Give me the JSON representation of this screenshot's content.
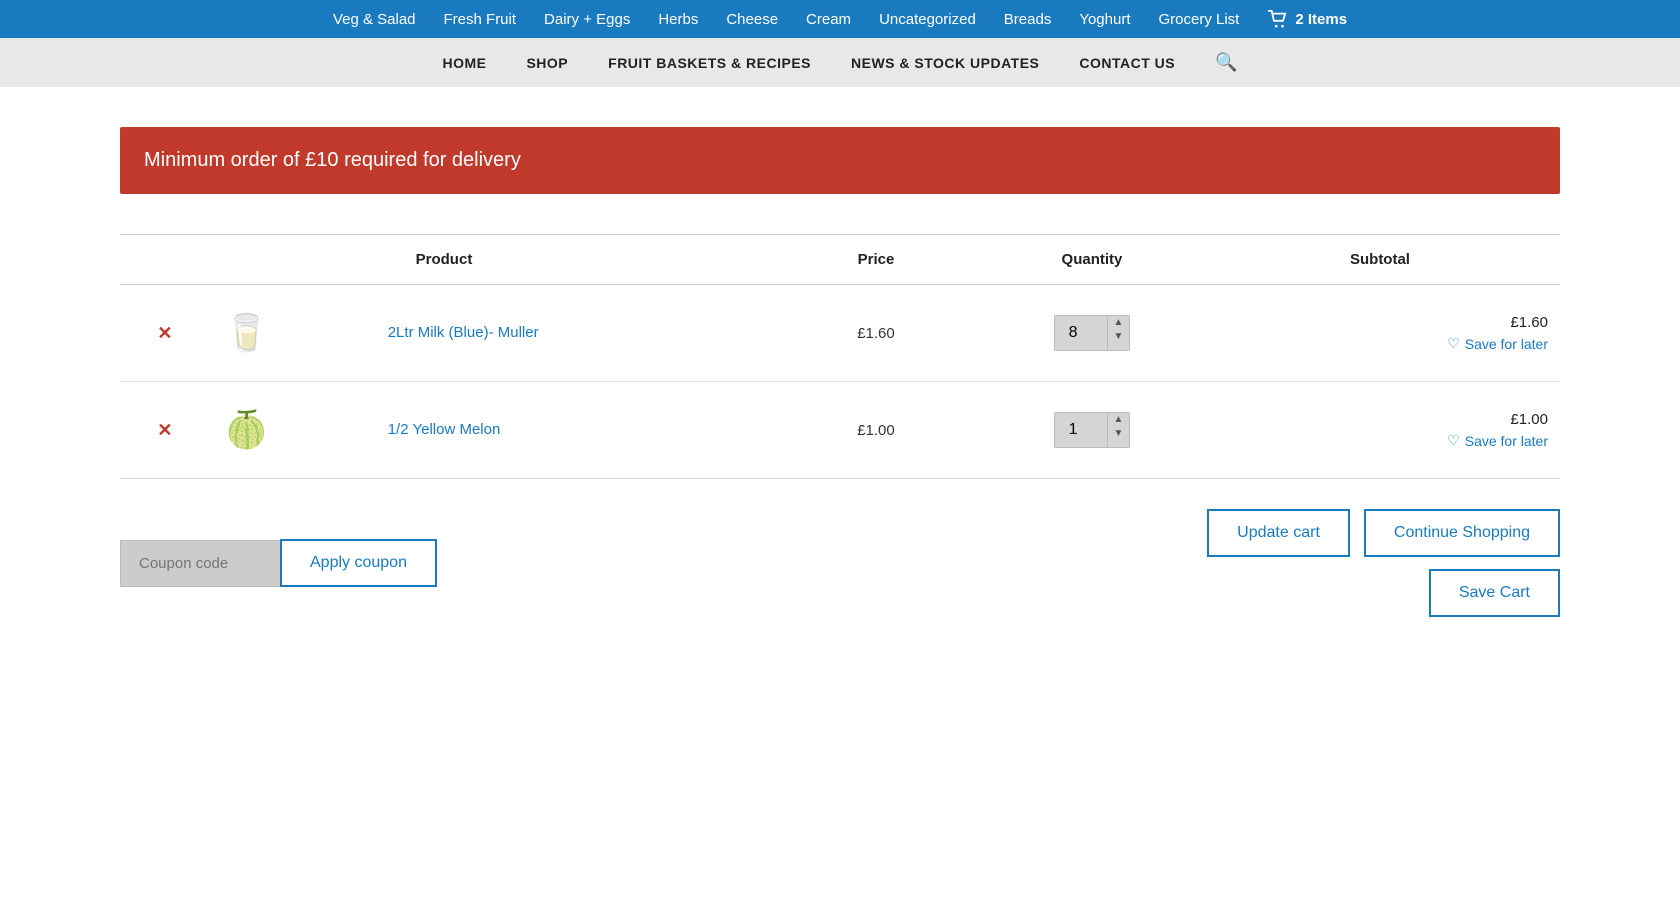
{
  "topNav": {
    "items": [
      {
        "label": "Veg & Salad",
        "href": "#"
      },
      {
        "label": "Fresh Fruit",
        "href": "#"
      },
      {
        "label": "Dairy + Eggs",
        "href": "#"
      },
      {
        "label": "Herbs",
        "href": "#"
      },
      {
        "label": "Cheese",
        "href": "#"
      },
      {
        "label": "Cream",
        "href": "#"
      },
      {
        "label": "Uncategorized",
        "href": "#"
      },
      {
        "label": "Breads",
        "href": "#"
      },
      {
        "label": "Yoghurt",
        "href": "#"
      },
      {
        "label": "Grocery List",
        "href": "#"
      }
    ],
    "cartLabel": "2 Items"
  },
  "mainNav": {
    "items": [
      {
        "label": "HOME",
        "href": "#"
      },
      {
        "label": "SHOP",
        "href": "#"
      },
      {
        "label": "FRUIT BASKETS & RECIPES",
        "href": "#"
      },
      {
        "label": "NEWS & STOCK UPDATES",
        "href": "#"
      },
      {
        "label": "CONTACT US",
        "href": "#"
      }
    ]
  },
  "alert": {
    "message": "Minimum order of £10 required for delivery"
  },
  "cartTable": {
    "headers": {
      "product": "Product",
      "price": "Price",
      "quantity": "Quantity",
      "subtotal": "Subtotal"
    },
    "rows": [
      {
        "id": "row1",
        "productName": "2Ltr Milk (Blue)- Muller",
        "price": "£1.60",
        "quantity": 8,
        "subtotal": "£1.60",
        "saveForLaterLabel": "Save for later",
        "emoji": "🥛"
      },
      {
        "id": "row2",
        "productName": "1/2 Yellow Melon",
        "price": "£1.00",
        "quantity": 1,
        "subtotal": "£1.00",
        "saveForLaterLabel": "Save for later",
        "emoji": "🍈"
      }
    ]
  },
  "actions": {
    "couponPlaceholder": "Coupon code",
    "applyCouponLabel": "Apply coupon",
    "updateCartLabel": "Update cart",
    "continueShoppingLabel": "Continue Shopping",
    "saveCartLabel": "Save Cart"
  },
  "colors": {
    "topNavBg": "#1a7abf",
    "alertBg": "#c0392b",
    "buttonBorder": "#1a7abf",
    "productLink": "#1a7abf",
    "removeBtn": "#c0392b"
  }
}
